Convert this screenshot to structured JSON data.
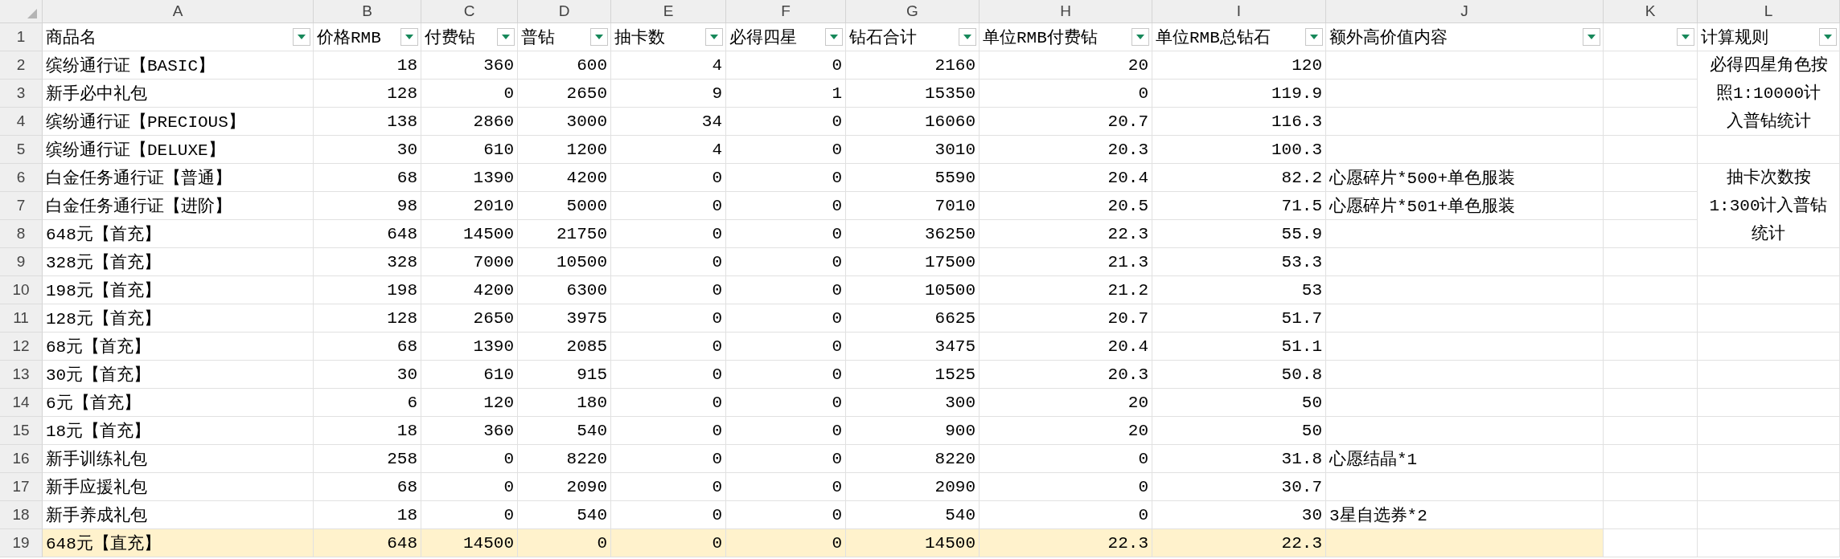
{
  "columns": [
    {
      "letter": "A",
      "header": "商品名",
      "filter": true
    },
    {
      "letter": "B",
      "header": "价格RMB",
      "filter": true
    },
    {
      "letter": "C",
      "header": "付费钻",
      "filter": true
    },
    {
      "letter": "D",
      "header": "普钻",
      "filter": true
    },
    {
      "letter": "E",
      "header": "抽卡数",
      "filter": true
    },
    {
      "letter": "F",
      "header": "必得四星",
      "filter": true
    },
    {
      "letter": "G",
      "header": "钻石合计",
      "filter": true
    },
    {
      "letter": "H",
      "header": "单位RMB付费钻",
      "filter": true
    },
    {
      "letter": "I",
      "header": "单位RMB总钻石",
      "filter": true
    },
    {
      "letter": "J",
      "header": "额外高价值内容",
      "filter": true
    },
    {
      "letter": "K",
      "filter": true
    },
    {
      "letter": "L",
      "header": "计算规则",
      "filter": true
    }
  ],
  "header_row_number": "1",
  "rows": [
    {
      "number": "2",
      "highlighted": false,
      "cells": {
        "A": "缤纷通行证【BASIC】",
        "B": "18",
        "C": "360",
        "D": "600",
        "E": "4",
        "F": "0",
        "G": "2160",
        "H": "20",
        "I": "120"
      },
      "note": "必得四星角色按照1:10000计入普钻统计"
    },
    {
      "number": "3",
      "highlighted": false,
      "cells": {
        "A": "新手必中礼包",
        "B": "128",
        "C": "0",
        "D": "2650",
        "E": "9",
        "F": "1",
        "G": "15350",
        "H": "0",
        "I": "119.9"
      }
    },
    {
      "number": "4",
      "highlighted": false,
      "cells": {
        "A": "缤纷通行证【PRECIOUS】",
        "B": "138",
        "C": "2860",
        "D": "3000",
        "E": "34",
        "F": "0",
        "G": "16060",
        "H": "20.7",
        "I": "116.3"
      }
    },
    {
      "number": "5",
      "highlighted": false,
      "cells": {
        "A": "缤纷通行证【DELUXE】",
        "B": "30",
        "C": "610",
        "D": "1200",
        "E": "4",
        "F": "0",
        "G": "3010",
        "H": "20.3",
        "I": "100.3"
      }
    },
    {
      "number": "6",
      "highlighted": false,
      "cells": {
        "A": "白金任务通行证【普通】",
        "B": "68",
        "C": "1390",
        "D": "4200",
        "E": "0",
        "F": "0",
        "G": "5590",
        "H": "20.4",
        "I": "82.2",
        "J": "心愿碎片*500+单色服装"
      },
      "note": "抽卡次数按1:300计入普钻统计"
    },
    {
      "number": "7",
      "highlighted": false,
      "cells": {
        "A": "白金任务通行证【进阶】",
        "B": "98",
        "C": "2010",
        "D": "5000",
        "E": "0",
        "F": "0",
        "G": "7010",
        "H": "20.5",
        "I": "71.5",
        "J": "心愿碎片*501+单色服装"
      }
    },
    {
      "number": "8",
      "highlighted": false,
      "cells": {
        "A": "648元【首充】",
        "B": "648",
        "C": "14500",
        "D": "21750",
        "E": "0",
        "F": "0",
        "G": "36250",
        "H": "22.3",
        "I": "55.9"
      }
    },
    {
      "number": "9",
      "highlighted": false,
      "cells": {
        "A": "328元【首充】",
        "B": "328",
        "C": "7000",
        "D": "10500",
        "E": "0",
        "F": "0",
        "G": "17500",
        "H": "21.3",
        "I": "53.3"
      }
    },
    {
      "number": "10",
      "highlighted": false,
      "cells": {
        "A": "198元【首充】",
        "B": "198",
        "C": "4200",
        "D": "6300",
        "E": "0",
        "F": "0",
        "G": "10500",
        "H": "21.2",
        "I": "53"
      }
    },
    {
      "number": "11",
      "highlighted": false,
      "cells": {
        "A": "128元【首充】",
        "B": "128",
        "C": "2650",
        "D": "3975",
        "E": "0",
        "F": "0",
        "G": "6625",
        "H": "20.7",
        "I": "51.7"
      }
    },
    {
      "number": "12",
      "highlighted": false,
      "cells": {
        "A": "68元【首充】",
        "B": "68",
        "C": "1390",
        "D": "2085",
        "E": "0",
        "F": "0",
        "G": "3475",
        "H": "20.4",
        "I": "51.1"
      }
    },
    {
      "number": "13",
      "highlighted": false,
      "cells": {
        "A": "30元【首充】",
        "B": "30",
        "C": "610",
        "D": "915",
        "E": "0",
        "F": "0",
        "G": "1525",
        "H": "20.3",
        "I": "50.8"
      }
    },
    {
      "number": "14",
      "highlighted": false,
      "cells": {
        "A": "6元【首充】",
        "B": "6",
        "C": "120",
        "D": "180",
        "E": "0",
        "F": "0",
        "G": "300",
        "H": "20",
        "I": "50"
      }
    },
    {
      "number": "15",
      "highlighted": false,
      "cells": {
        "A": "18元【首充】",
        "B": "18",
        "C": "360",
        "D": "540",
        "E": "0",
        "F": "0",
        "G": "900",
        "H": "20",
        "I": "50"
      }
    },
    {
      "number": "16",
      "highlighted": false,
      "cells": {
        "A": "新手训练礼包",
        "B": "258",
        "C": "0",
        "D": "8220",
        "E": "0",
        "F": "0",
        "G": "8220",
        "H": "0",
        "I": "31.8",
        "J": "心愿结晶*1"
      }
    },
    {
      "number": "17",
      "highlighted": false,
      "cells": {
        "A": "新手应援礼包",
        "B": "68",
        "C": "0",
        "D": "2090",
        "E": "0",
        "F": "0",
        "G": "2090",
        "H": "0",
        "I": "30.7"
      }
    },
    {
      "number": "18",
      "highlighted": false,
      "cells": {
        "A": "新手养成礼包",
        "B": "18",
        "C": "0",
        "D": "540",
        "E": "0",
        "F": "0",
        "G": "540",
        "H": "0",
        "I": "30",
        "J": "3星自选券*2"
      }
    },
    {
      "number": "19",
      "highlighted": true,
      "cells": {
        "A": "648元【直充】",
        "B": "648",
        "C": "14500",
        "D": "0",
        "E": "0",
        "F": "0",
        "G": "14500",
        "H": "22.3",
        "I": "22.3"
      }
    }
  ]
}
